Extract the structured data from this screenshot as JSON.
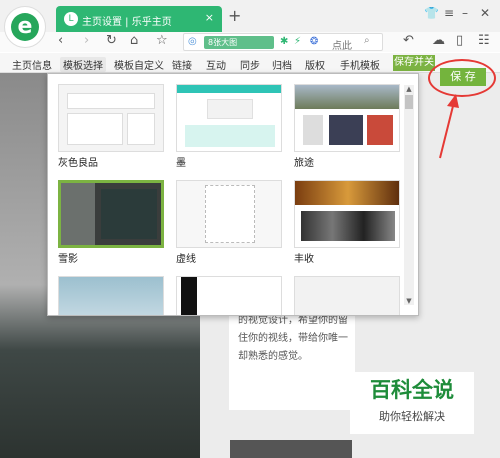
{
  "browser": {
    "tab_title": "主页设置 | 乐乎主页",
    "tab_close": "×",
    "tab_add": "+",
    "url_chip_text": "8张大图",
    "url_text": "点此"
  },
  "menu": {
    "items": [
      "主页信息",
      "模板选择",
      "模板自定义",
      "链接",
      "互动",
      "同步",
      "归档",
      "版权",
      "手机模板"
    ],
    "active_index": 1,
    "save_toggle": "保存并关"
  },
  "save_button": {
    "label": "保 存",
    "color": "#74b43d"
  },
  "highlight_color": "#e53935",
  "templates": [
    {
      "label": "灰色良品",
      "style": "grey"
    },
    {
      "label": "墨",
      "style": "ink"
    },
    {
      "label": "旅途",
      "style": "travel"
    },
    {
      "label": "雪影",
      "style": "snow",
      "selected": true
    },
    {
      "label": "虚线",
      "style": "dashed"
    },
    {
      "label": "丰收",
      "style": "harvest"
    },
    {
      "label": "",
      "style": "sky"
    },
    {
      "label": "",
      "style": "dark"
    },
    {
      "label": "",
      "style": "light"
    }
  ],
  "background_page": {
    "text": "的视觉设计，希望你的留住你的视线，带给你唯一却熟悉的感觉。"
  },
  "watermark": {
    "title": "百科全说",
    "subtitle": "助你轻松解决"
  },
  "accent_color": "#7cb342"
}
